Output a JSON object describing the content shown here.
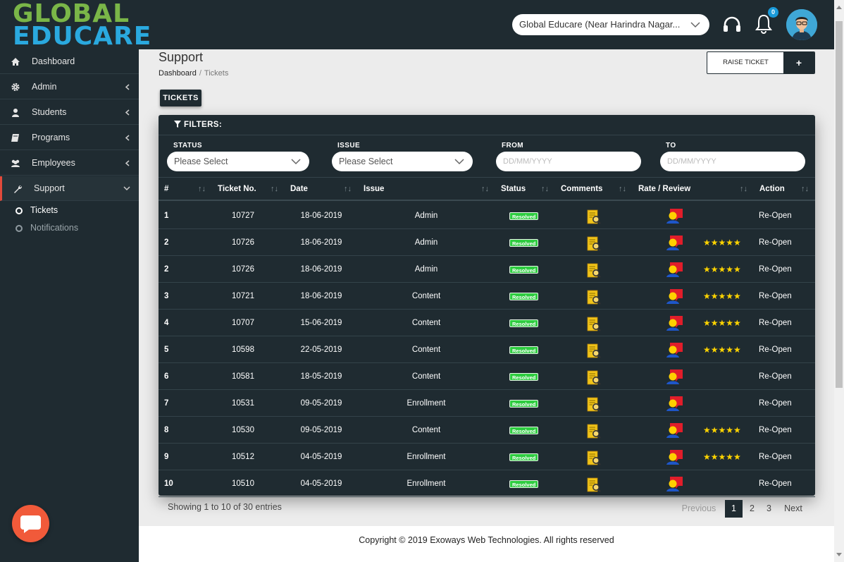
{
  "logo": {
    "line1": "GLOBAL",
    "line2": "EDUCARE"
  },
  "header": {
    "org_select": "Global Educare (Near Harindra Nagar...",
    "notification_count": "0",
    "icons": [
      "headset-icon",
      "bell-icon",
      "avatar"
    ]
  },
  "sidebar": {
    "items": [
      {
        "label": "Dashboard",
        "icon": "home-icon"
      },
      {
        "label": "Admin",
        "icon": "gear-icon"
      },
      {
        "label": "Students",
        "icon": "user-icon"
      },
      {
        "label": "Programs",
        "icon": "book-icon"
      },
      {
        "label": "Employees",
        "icon": "users-icon"
      },
      {
        "label": "Support",
        "icon": "wrench-icon"
      }
    ],
    "sub_items": [
      {
        "label": "Tickets"
      },
      {
        "label": "Notifications"
      }
    ]
  },
  "page": {
    "title": "Support",
    "breadcrumb": {
      "home": "Dashboard",
      "sep": "/",
      "current": "Tickets"
    },
    "raise_ticket_label": "RAISE TICKET",
    "plus_label": "+",
    "tab_label": "TICKETS"
  },
  "filters": {
    "title": "FILTERS:",
    "status_label": "STATUS",
    "status_value": "Please Select",
    "issue_label": "ISSUE",
    "issue_value": "Please Select",
    "from_label": "FROM",
    "from_placeholder": "DD/MM/YYYY",
    "to_label": "TO",
    "to_placeholder": "DD/MM/YYYY"
  },
  "table": {
    "columns": [
      "#",
      "Ticket No.",
      "Date",
      "Issue",
      "Status",
      "Comments",
      "Rate / Review",
      "Action"
    ],
    "rows": [
      {
        "num": "1",
        "ticket": "10727",
        "date": "18-06-2019",
        "issue": "Admin",
        "status": "Resolved",
        "stars": "",
        "action": "Re-Open"
      },
      {
        "num": "2",
        "ticket": "10726",
        "date": "18-06-2019",
        "issue": "Admin",
        "status": "Resolved",
        "stars": "★★★★★",
        "action": "Re-Open"
      },
      {
        "num": "2",
        "ticket": "10726",
        "date": "18-06-2019",
        "issue": "Admin",
        "status": "Resolved",
        "stars": "★★★★★",
        "action": "Re-Open"
      },
      {
        "num": "3",
        "ticket": "10721",
        "date": "18-06-2019",
        "issue": "Content",
        "status": "Resolved",
        "stars": "★★★★★",
        "action": "Re-Open"
      },
      {
        "num": "4",
        "ticket": "10707",
        "date": "15-06-2019",
        "issue": "Content",
        "status": "Resolved",
        "stars": "★★★★★",
        "action": "Re-Open"
      },
      {
        "num": "5",
        "ticket": "10598",
        "date": "22-05-2019",
        "issue": "Content",
        "status": "Resolved",
        "stars": "★★★★★",
        "action": "Re-Open"
      },
      {
        "num": "6",
        "ticket": "10581",
        "date": "18-05-2019",
        "issue": "Content",
        "status": "Resolved",
        "stars": "",
        "action": "Re-Open"
      },
      {
        "num": "7",
        "ticket": "10531",
        "date": "09-05-2019",
        "issue": "Enrollment",
        "status": "Resolved",
        "stars": "",
        "action": "Re-Open"
      },
      {
        "num": "8",
        "ticket": "10530",
        "date": "09-05-2019",
        "issue": "Content",
        "status": "Resolved",
        "stars": "★★★★★",
        "action": "Re-Open"
      },
      {
        "num": "9",
        "ticket": "10512",
        "date": "04-05-2019",
        "issue": "Enrollment",
        "status": "Resolved",
        "stars": "★★★★★",
        "action": "Re-Open"
      },
      {
        "num": "10",
        "ticket": "10510",
        "date": "04-05-2019",
        "issue": "Enrollment",
        "status": "Resolved",
        "stars": "",
        "action": "Re-Open"
      }
    ]
  },
  "pagination": {
    "showing": "Showing 1 to 10 of 30 entries",
    "previous": "Previous",
    "pages": [
      "1",
      "2",
      "3"
    ],
    "next": "Next"
  },
  "footer": {
    "copyright": "Copyright © 2019 Exoways Web Technologies. All rights reserved"
  },
  "colors": {
    "dark": "#1f2b31",
    "accent": "#e24a3b",
    "resolved": "#2ecc40",
    "stars": "#ffd400",
    "chat": "#f15a3a"
  }
}
